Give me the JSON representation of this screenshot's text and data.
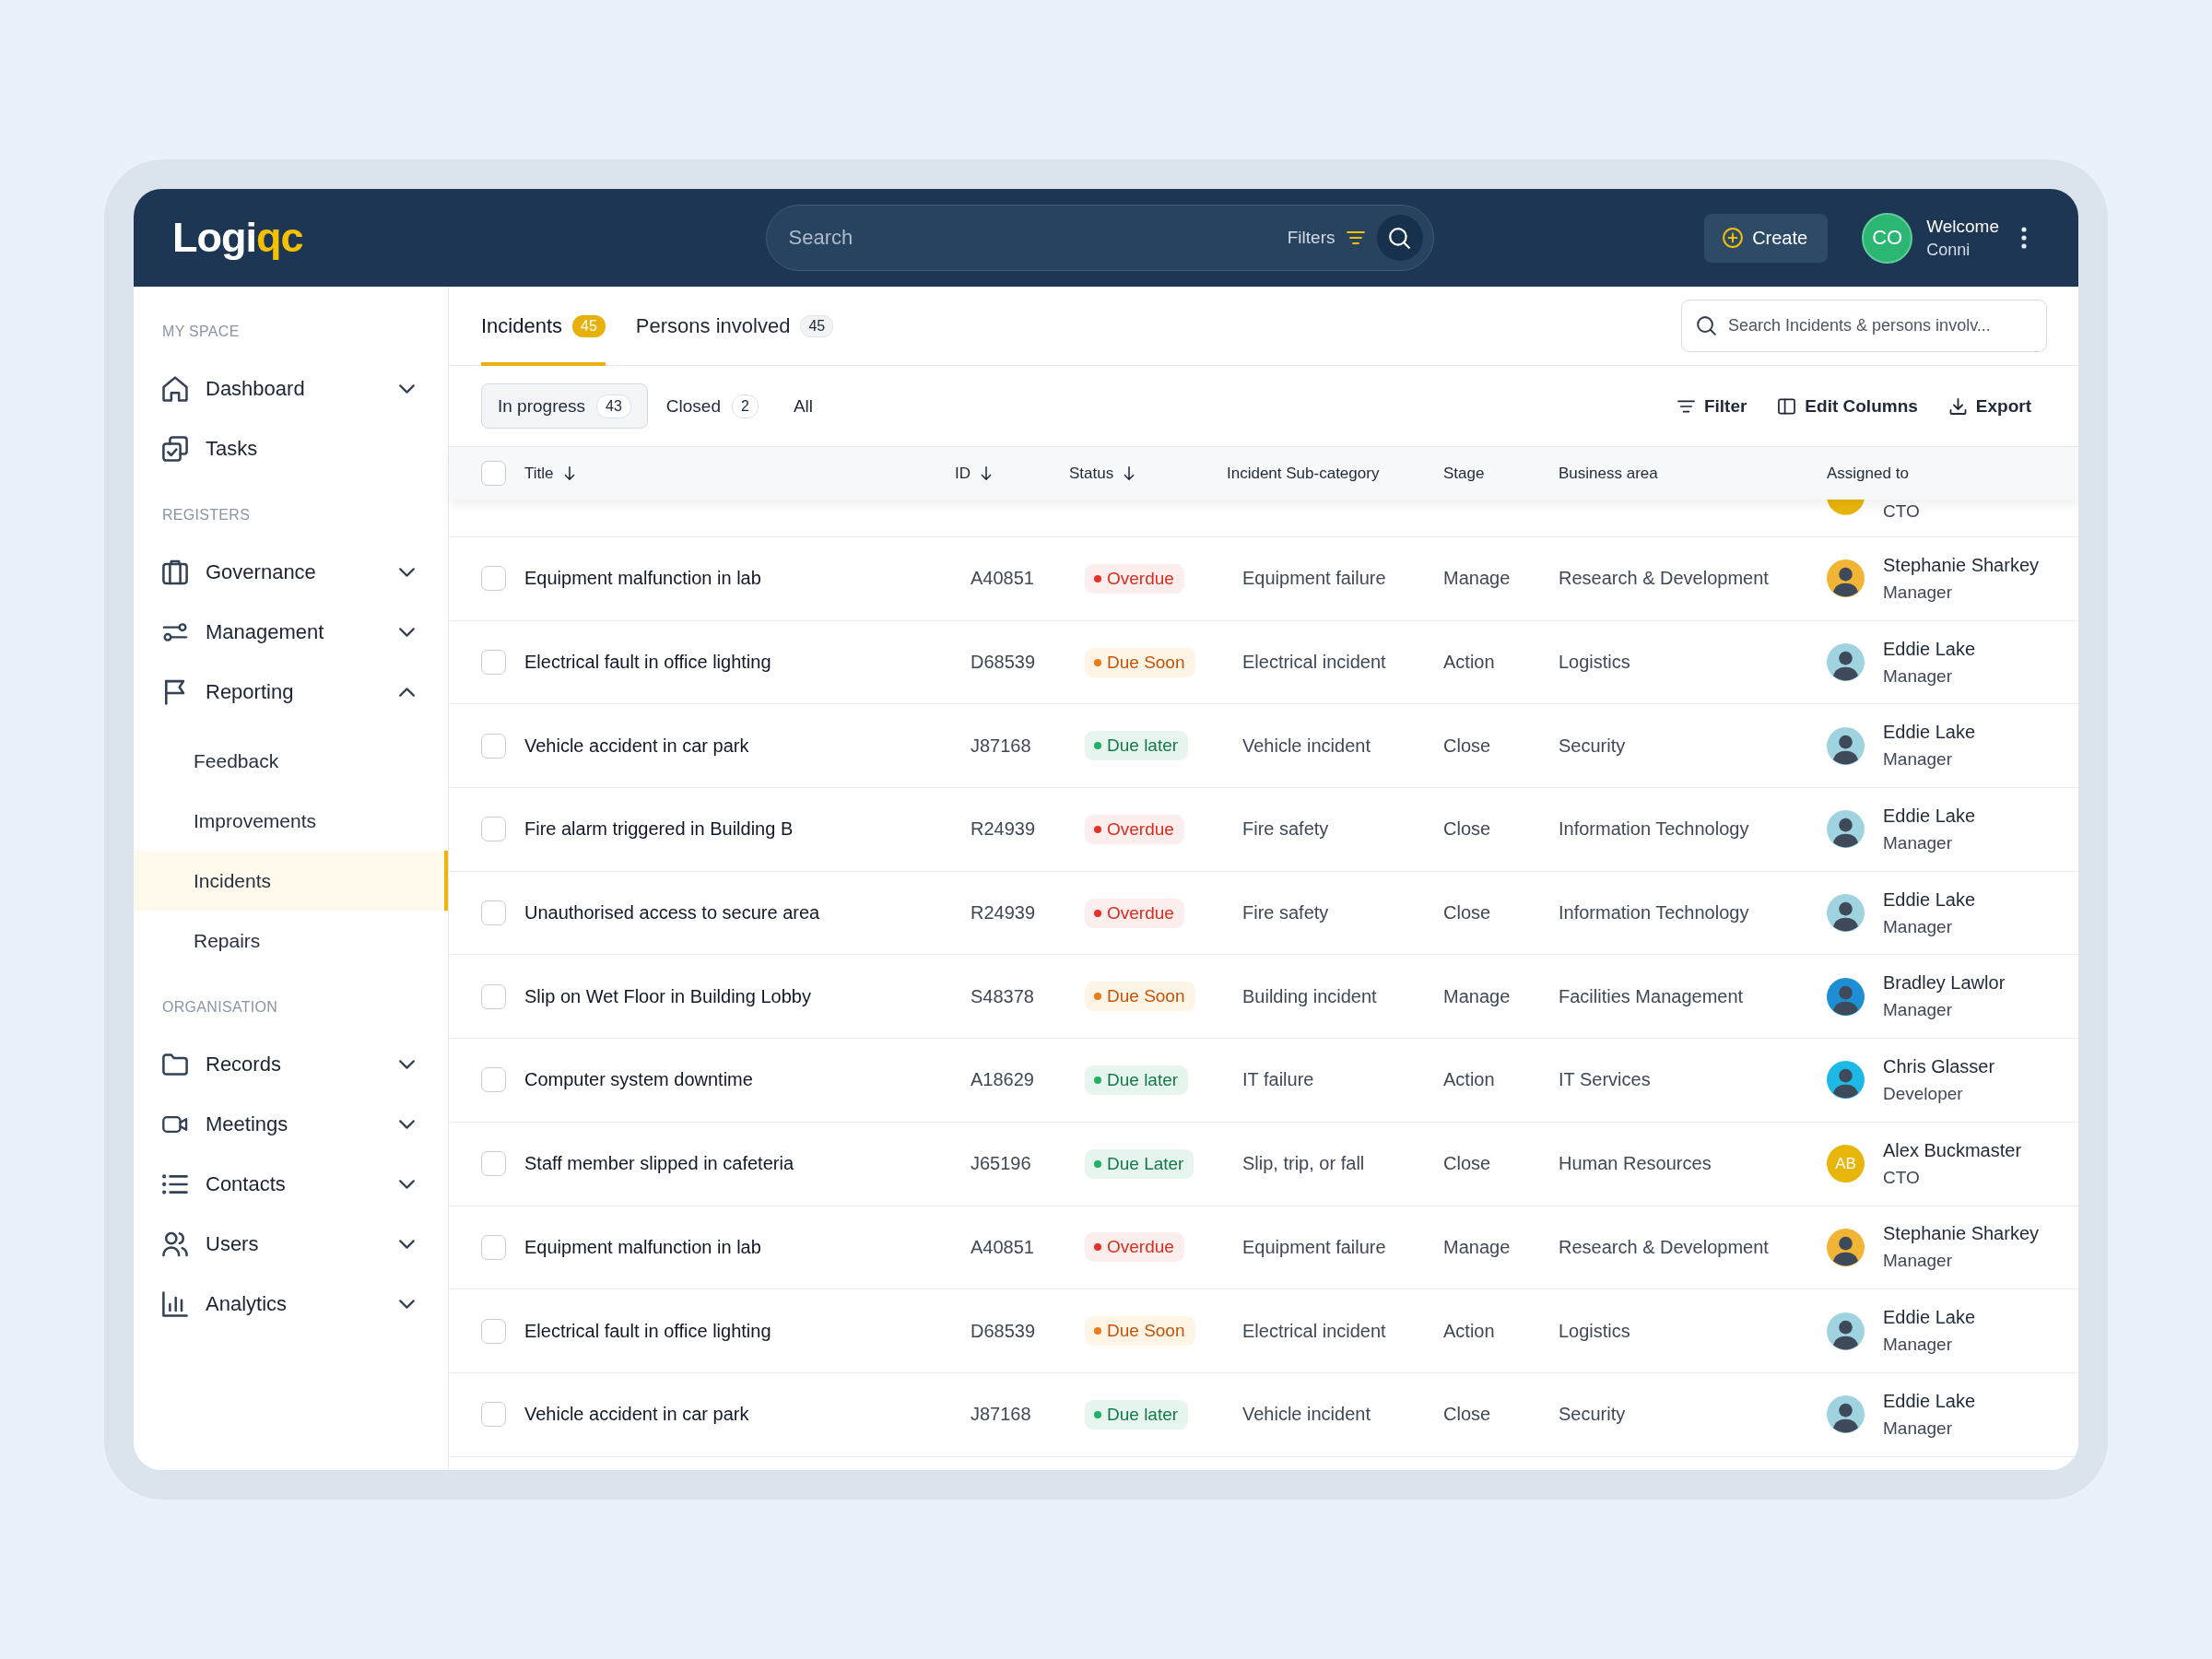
{
  "header": {
    "logo": {
      "main": "Logi",
      "accent": "qc"
    },
    "search": {
      "placeholder": "Search",
      "filters_label": "Filters"
    },
    "create_button": "Create",
    "user": {
      "initials": "CO",
      "greeting": "Welcome",
      "name": "Conni"
    }
  },
  "sidebar": {
    "sections": [
      {
        "heading": "MY SPACE",
        "items": [
          {
            "label": "Dashboard",
            "kind": "group",
            "expanded": false,
            "selected": false
          },
          {
            "label": "Tasks",
            "kind": "link",
            "selected": false
          }
        ]
      },
      {
        "heading": "REGISTERS",
        "items": [
          {
            "label": "Governance",
            "kind": "group",
            "expanded": false,
            "selected": false
          },
          {
            "label": "Management",
            "kind": "group",
            "expanded": false,
            "selected": false
          },
          {
            "label": "Reporting",
            "kind": "group",
            "expanded": true,
            "selected": false,
            "children": [
              {
                "label": "Feedback",
                "selected": false
              },
              {
                "label": "Improvements",
                "selected": false
              },
              {
                "label": "Incidents",
                "selected": true
              },
              {
                "label": "Repairs",
                "selected": false
              }
            ]
          }
        ]
      },
      {
        "heading": "ORGANISATION",
        "items": [
          {
            "label": "Records",
            "kind": "group",
            "expanded": false,
            "selected": false
          },
          {
            "label": "Meetings",
            "kind": "group",
            "expanded": false,
            "selected": false
          },
          {
            "label": "Contacts",
            "kind": "group",
            "expanded": false,
            "selected": false
          },
          {
            "label": "Users",
            "kind": "group",
            "expanded": false,
            "selected": false
          },
          {
            "label": "Analytics",
            "kind": "group",
            "expanded": false,
            "selected": false
          }
        ]
      }
    ]
  },
  "tabs": [
    {
      "label": "Incidents",
      "count": "45",
      "selected": true
    },
    {
      "label": "Persons involved",
      "count": "45",
      "selected": false
    }
  ],
  "incident_search": {
    "placeholder": "Search Incidents & persons involv..."
  },
  "status_filters": [
    {
      "label": "In progress",
      "count": "43",
      "selected": true
    },
    {
      "label": "Closed",
      "count": "2",
      "selected": false
    },
    {
      "label": "All",
      "selected": false
    }
  ],
  "actions": [
    {
      "label": "Filter"
    },
    {
      "label": "Edit Columns"
    },
    {
      "label": "Export"
    }
  ],
  "table": {
    "select_all": {
      "checked": false
    },
    "columns": [
      {
        "label": "Title",
        "sorted": true
      },
      {
        "label": "ID",
        "sorted": true
      },
      {
        "label": "Status",
        "sorted": true
      },
      {
        "label": "Incident Sub-category",
        "sorted": false
      },
      {
        "label": "Stage",
        "sorted": false
      },
      {
        "label": "Business area",
        "sorted": false
      },
      {
        "label": "Assigned to",
        "sorted": false
      }
    ],
    "clipped_row": {
      "assignee": {
        "role": "CTO",
        "color": "#e8b50a"
      }
    },
    "rows": [
      {
        "checked": false,
        "title": "Equipment malfunction in lab",
        "id": "A40851",
        "status": {
          "label": "Overdue",
          "kind": "overdue"
        },
        "sub_category": "Equipment failure",
        "stage": "Manage",
        "business_area": "Research & Development",
        "assignee": {
          "kind": "photo",
          "name": "Stephanie Sharkey",
          "role": "Manager",
          "color": "#f1b434"
        }
      },
      {
        "checked": false,
        "title": "Electrical fault in office lighting",
        "id": "D68539",
        "status": {
          "label": "Due Soon",
          "kind": "soon"
        },
        "sub_category": "Electrical incident",
        "stage": "Action",
        "business_area": "Logistics",
        "assignee": {
          "kind": "photo",
          "name": "Eddie Lake",
          "role": "Manager",
          "color": "#9ed3df"
        }
      },
      {
        "checked": false,
        "title": "Vehicle accident in car park",
        "id": "J87168",
        "status": {
          "label": "Due later",
          "kind": "later"
        },
        "sub_category": "Vehicle incident",
        "stage": "Close",
        "business_area": "Security",
        "assignee": {
          "kind": "photo",
          "name": "Eddie Lake",
          "role": "Manager",
          "color": "#9ed3df"
        }
      },
      {
        "checked": false,
        "title": "Fire alarm triggered in Building B",
        "id": "R24939",
        "status": {
          "label": "Overdue",
          "kind": "overdue"
        },
        "sub_category": "Fire safety",
        "stage": "Close",
        "business_area": "Information Technology",
        "assignee": {
          "kind": "photo",
          "name": "Eddie Lake",
          "role": "Manager",
          "color": "#9ed3df"
        }
      },
      {
        "checked": false,
        "title": "Unauthorised access to secure area",
        "id": "R24939",
        "status": {
          "label": "Overdue",
          "kind": "overdue"
        },
        "sub_category": "Fire safety",
        "stage": "Close",
        "business_area": "Information Technology",
        "assignee": {
          "kind": "photo",
          "name": "Eddie Lake",
          "role": "Manager",
          "color": "#9ed3df"
        }
      },
      {
        "checked": false,
        "title": "Slip on Wet Floor in Building Lobby",
        "id": "S48378",
        "status": {
          "label": "Due Soon",
          "kind": "soon"
        },
        "sub_category": "Building incident",
        "stage": "Manage",
        "business_area": "Facilities Management",
        "assignee": {
          "kind": "photo",
          "name": "Bradley Lawlor",
          "role": "Manager",
          "color": "#1e8fd5"
        }
      },
      {
        "checked": false,
        "title": "Computer system downtime",
        "id": "A18629",
        "status": {
          "label": "Due later",
          "kind": "later"
        },
        "sub_category": "IT failure",
        "stage": "Action",
        "business_area": "IT Services",
        "assignee": {
          "kind": "photo",
          "name": "Chris Glasser",
          "role": "Developer",
          "color": "#1cb8e6"
        }
      },
      {
        "checked": false,
        "title": "Staff member slipped in cafeteria",
        "id": "J65196",
        "status": {
          "label": "Due Later",
          "kind": "later"
        },
        "sub_category": "Slip, trip, or fall",
        "stage": "Close",
        "business_area": "Human Resources",
        "assignee": {
          "kind": "initials",
          "initials": "AB",
          "name": "Alex Buckmaster",
          "role": "CTO",
          "color": "#e8b50a"
        }
      },
      {
        "checked": false,
        "title": "Equipment malfunction in lab",
        "id": "A40851",
        "status": {
          "label": "Overdue",
          "kind": "overdue"
        },
        "sub_category": "Equipment failure",
        "stage": "Manage",
        "business_area": "Research & Development",
        "assignee": {
          "kind": "photo",
          "name": "Stephanie Sharkey",
          "role": "Manager",
          "color": "#f1b434"
        }
      },
      {
        "checked": false,
        "title": "Electrical fault in office lighting",
        "id": "D68539",
        "status": {
          "label": "Due Soon",
          "kind": "soon"
        },
        "sub_category": "Electrical incident",
        "stage": "Action",
        "business_area": "Logistics",
        "assignee": {
          "kind": "photo",
          "name": "Eddie Lake",
          "role": "Manager",
          "color": "#9ed3df"
        }
      },
      {
        "checked": false,
        "title": "Vehicle accident in car park",
        "id": "J87168",
        "status": {
          "label": "Due later",
          "kind": "later"
        },
        "sub_category": "Vehicle incident",
        "stage": "Close",
        "business_area": "Security",
        "assignee": {
          "kind": "photo",
          "name": "Eddie Lake",
          "role": "Manager",
          "color": "#9ed3df"
        }
      }
    ]
  }
}
